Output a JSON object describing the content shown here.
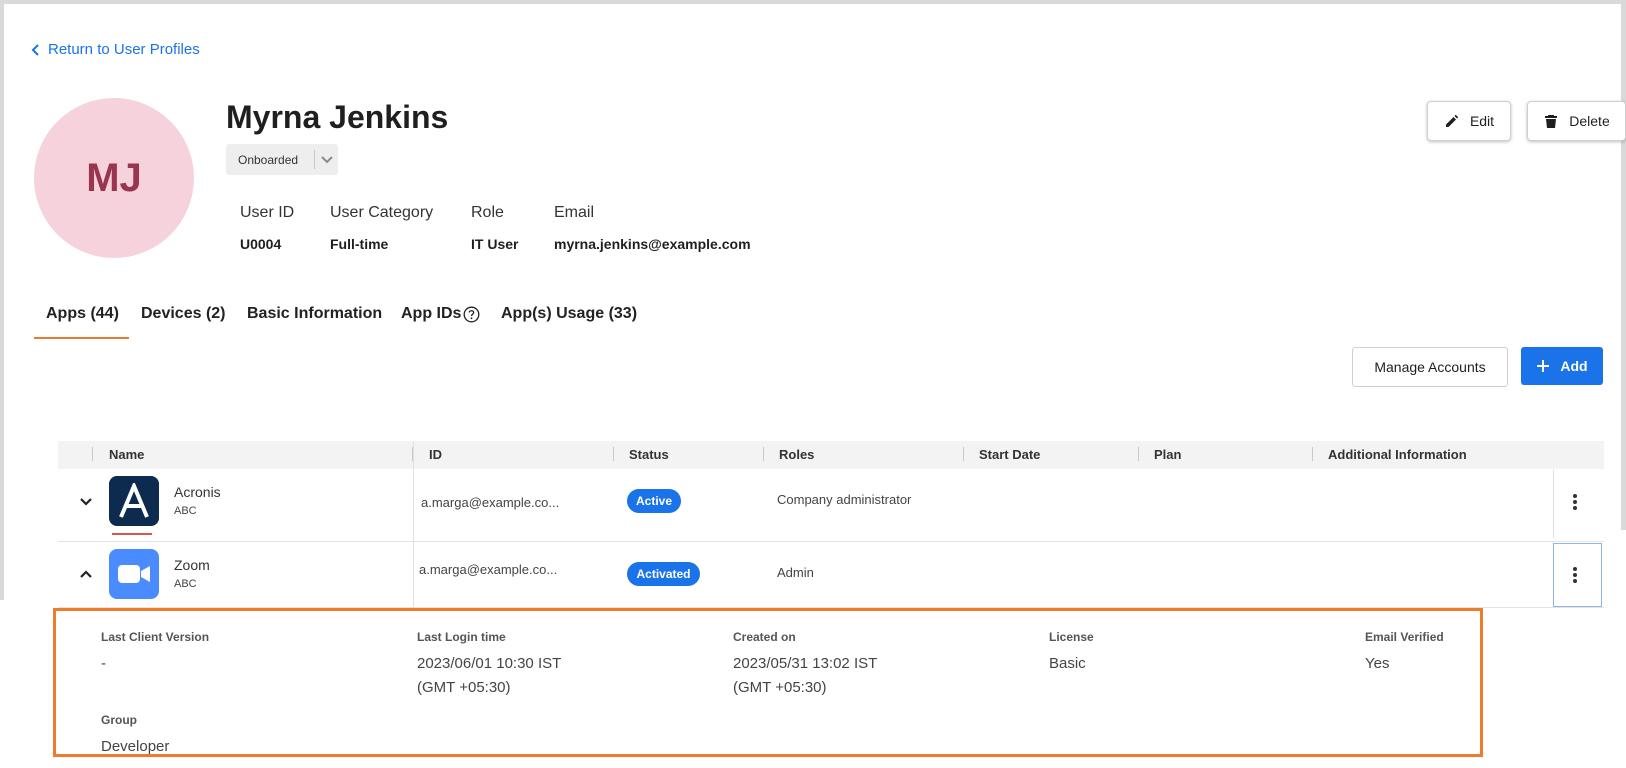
{
  "nav": {
    "back_label": "Return to User Profiles"
  },
  "user": {
    "initials": "MJ",
    "name": "Myrna Jenkins",
    "status": "Onboarded",
    "fields": [
      {
        "label": "User ID",
        "value": "U0004"
      },
      {
        "label": "User Category",
        "value": "Full-time"
      },
      {
        "label": "Role",
        "value": "IT User"
      },
      {
        "label": "Email",
        "value": "myrna.jenkins@example.com"
      }
    ]
  },
  "actions": {
    "edit_label": "Edit",
    "delete_label": "Delete"
  },
  "tabs": [
    {
      "label": "Apps (44)",
      "active": true
    },
    {
      "label": "Devices (2)"
    },
    {
      "label": "Basic Information"
    },
    {
      "label": "App IDs"
    },
    {
      "label": "App(s) Usage (33)"
    }
  ],
  "toolbar": {
    "manage_label": "Manage Accounts",
    "add_label": "Add"
  },
  "table": {
    "columns": [
      "Name",
      "ID",
      "Status",
      "Roles",
      "Start Date",
      "Plan",
      "Additional Information"
    ],
    "rows": [
      {
        "name": "Acronis",
        "sub": "ABC",
        "id": "a.marga@example.co...",
        "status": "Active",
        "role": "Company administrator",
        "icon": "acronis-logo"
      },
      {
        "name": "Zoom",
        "sub": "ABC",
        "id": "a.marga@example.co...",
        "status": "Activated",
        "role": "Admin",
        "icon": "zoom-logo"
      }
    ]
  },
  "details": {
    "last_client_version": {
      "label": "Last Client Version",
      "value": "-"
    },
    "last_login": {
      "label": "Last Login time",
      "value1": "2023/06/01 10:30 IST",
      "value2": "(GMT +05:30)"
    },
    "created_on": {
      "label": "Created on",
      "value1": "2023/05/31 13:02 IST",
      "value2": "(GMT +05:30)"
    },
    "license": {
      "label": "License",
      "value": "Basic"
    },
    "email_verified": {
      "label": "Email Verified",
      "value": "Yes"
    },
    "group": {
      "label": "Group",
      "value": "Developer"
    }
  },
  "colors": {
    "accent": "#1a73e8",
    "tab_indicator": "#e8792e",
    "avatar_bg": "#f5d2dc",
    "avatar_text": "#9a3550",
    "highlight_border": "#ee7b2e"
  }
}
